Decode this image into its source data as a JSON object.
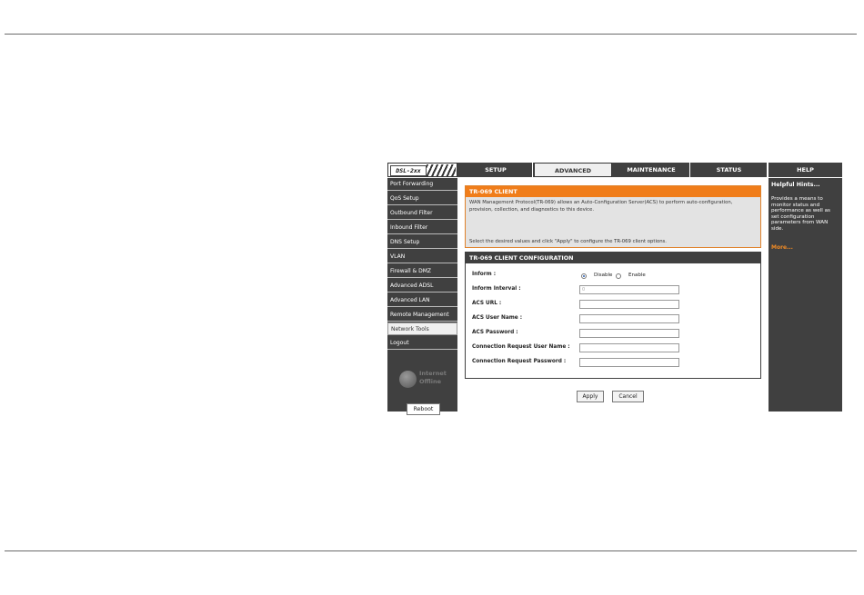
{
  "header": {
    "logo": "DSL-2xx",
    "tabs": [
      {
        "label": "SETUP",
        "active": false
      },
      {
        "label": "ADVANCED",
        "active": true
      },
      {
        "label": "MAINTENANCE",
        "active": false
      },
      {
        "label": "STATUS",
        "active": false
      }
    ],
    "help_tab": "HELP"
  },
  "sidebar": {
    "items": [
      {
        "label": "Port Forwarding",
        "active": false
      },
      {
        "label": "QoS Setup",
        "active": false
      },
      {
        "label": "Outbound Filter",
        "active": false
      },
      {
        "label": "Inbound Filter",
        "active": false
      },
      {
        "label": "DNS Setup",
        "active": false
      },
      {
        "label": "VLAN",
        "active": false
      },
      {
        "label": "Firewall & DMZ",
        "active": false
      },
      {
        "label": "Advanced ADSL",
        "active": false
      },
      {
        "label": "Advanced LAN",
        "active": false
      },
      {
        "label": "Remote Management",
        "active": false
      },
      {
        "label": "Network Tools",
        "active": true
      },
      {
        "label": "Logout",
        "active": false
      }
    ],
    "status_line1": "Internet",
    "status_line2": "Offline",
    "reboot_label": "Reboot"
  },
  "tr069": {
    "title": "TR-069 CLIENT",
    "description": "WAN Management Protocol(TR-069) allows an Auto-Configuration Server(ACS) to perform auto-configuration, provision, collection, and diagnostics to this device.",
    "instruction": "Select the desired values and click \"Apply\" to configure the TR-069 client options."
  },
  "config": {
    "title": "TR-069 CLIENT CONFIGURATION",
    "inform_label": "Inform :",
    "inform_options": [
      "Disable",
      "Enable"
    ],
    "inform_selected": "Disable",
    "inform_interval_label": "Inform Interval :",
    "inform_interval_value": "0",
    "acs_url_label": "ACS URL :",
    "acs_url_value": "",
    "acs_user_label": "ACS User Name :",
    "acs_user_value": "",
    "acs_password_label": "ACS Password :",
    "acs_password_value": "",
    "conn_user_label": "Connection Request User Name :",
    "conn_user_value": "",
    "conn_password_label": "Connection Request Password :",
    "conn_password_value": ""
  },
  "buttons": {
    "apply": "Apply",
    "cancel": "Cancel"
  },
  "help": {
    "title": "Helpful Hints...",
    "text": "Provides a means to monitor status and performance as well as set configuration parameters from WAN side.",
    "more": "More..."
  },
  "colors": {
    "accent": "#f07d1a",
    "dark": "#404040"
  }
}
